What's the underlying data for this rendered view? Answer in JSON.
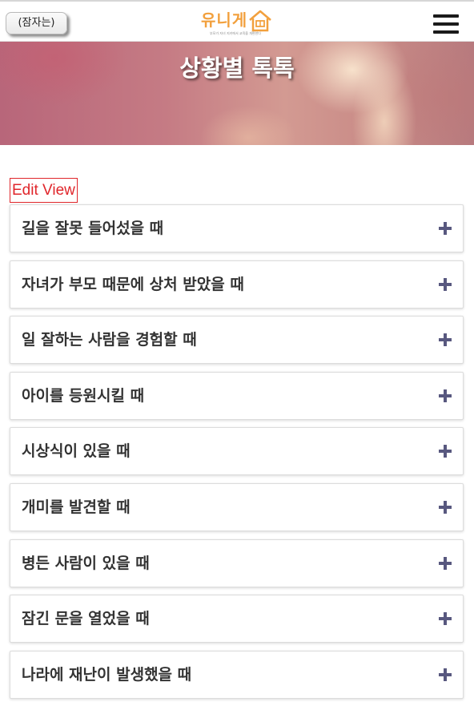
{
  "header": {
    "lang_button_label": "(잠자는)",
    "logo": {
      "text": "유니게",
      "tagline": "부모가 자녀 지키에서 교육을 개편한다",
      "color": "#f2a03d"
    },
    "menu_icon": "hamburger-icon"
  },
  "hero": {
    "title": "상황별 톡톡"
  },
  "edit_view_label": "Edit View",
  "accordion": {
    "expand_icon": "plus-icon",
    "icon_color": "#58587f",
    "items": [
      {
        "label": "길을 잘못 들어섰을 때"
      },
      {
        "label": "자녀가 부모 때문에 상처 받았을 때"
      },
      {
        "label": "일 잘하는 사람을 경험할 때"
      },
      {
        "label": "아이를 등원시킬 때"
      },
      {
        "label": "시상식이 있을 때"
      },
      {
        "label": "개미를 발견할 때"
      },
      {
        "label": "병든 사람이 있을 때"
      },
      {
        "label": "잠긴 문을 열었을 때"
      },
      {
        "label": "나라에 재난이 발생했을 때"
      }
    ]
  }
}
